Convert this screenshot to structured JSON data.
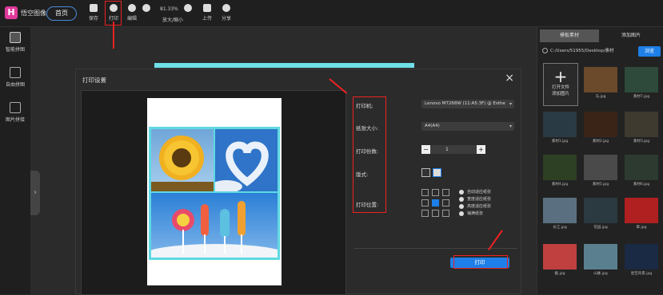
{
  "app": {
    "name": "悟空图像",
    "logo_letter": "H",
    "home_label": "首页"
  },
  "toolbar": {
    "save": "保存",
    "print": "打印",
    "edit": "编辑",
    "zoom_value": "81.33%",
    "zoom_label": "放大/缩小",
    "upload": "上传",
    "share": "分享"
  },
  "leftbar": {
    "items": [
      {
        "label": "智能拼图"
      },
      {
        "label": "自由拼图"
      },
      {
        "label": "图片拼接"
      }
    ]
  },
  "rightpanel": {
    "tabs": [
      "模板素材",
      "添加图片"
    ],
    "path": "C:/Users/51955/Desktop/素材",
    "browse": "浏览",
    "open_tile": {
      "line1": "打开文件",
      "line2": "添加图片"
    },
    "thumbs": [
      {
        "label": "马.jpg",
        "color": "#6a4a2a"
      },
      {
        "label": "素材7.jpg",
        "color": "#2e4a3a"
      },
      {
        "label": "素材1.jpg",
        "color": "#2a3a44"
      },
      {
        "label": "素材2.jpg",
        "color": "#3a2418"
      },
      {
        "label": "素材3.jpg",
        "color": "#3e3a30"
      },
      {
        "label": "素材4.jpg",
        "color": "#2e4024"
      },
      {
        "label": "素材5.jpg",
        "color": "#4a4a4a"
      },
      {
        "label": "素材6.jpg",
        "color": "#2c3a30"
      },
      {
        "label": "长江.jpg",
        "color": "#5a7080"
      },
      {
        "label": "花园.jpg",
        "color": "#2a3a40"
      },
      {
        "label": "章.jpg",
        "color": "#b02020"
      },
      {
        "label": "截.jpg",
        "color": "#c04040"
      },
      {
        "label": "山脉.jpg",
        "color": "#5a8090"
      },
      {
        "label": "星空背景.jpg",
        "color": "#1a2a44"
      }
    ]
  },
  "dialog": {
    "title": "打印设置",
    "close": "×",
    "labels": {
      "printer": "打印机:",
      "paper": "纸张大小:",
      "copies": "打印份数:",
      "orientation": "版式:",
      "position": "打印位置:"
    },
    "printer_value": "Lenovo M7268W (11:A5:3F) @ Esthe",
    "paper_value": "A4(A4)",
    "copies_value": "1",
    "position_options": [
      "自动适应纸张",
      "宽度适应纸张",
      "高度适应纸张",
      "铺满纸张"
    ],
    "print_button": "打印"
  }
}
